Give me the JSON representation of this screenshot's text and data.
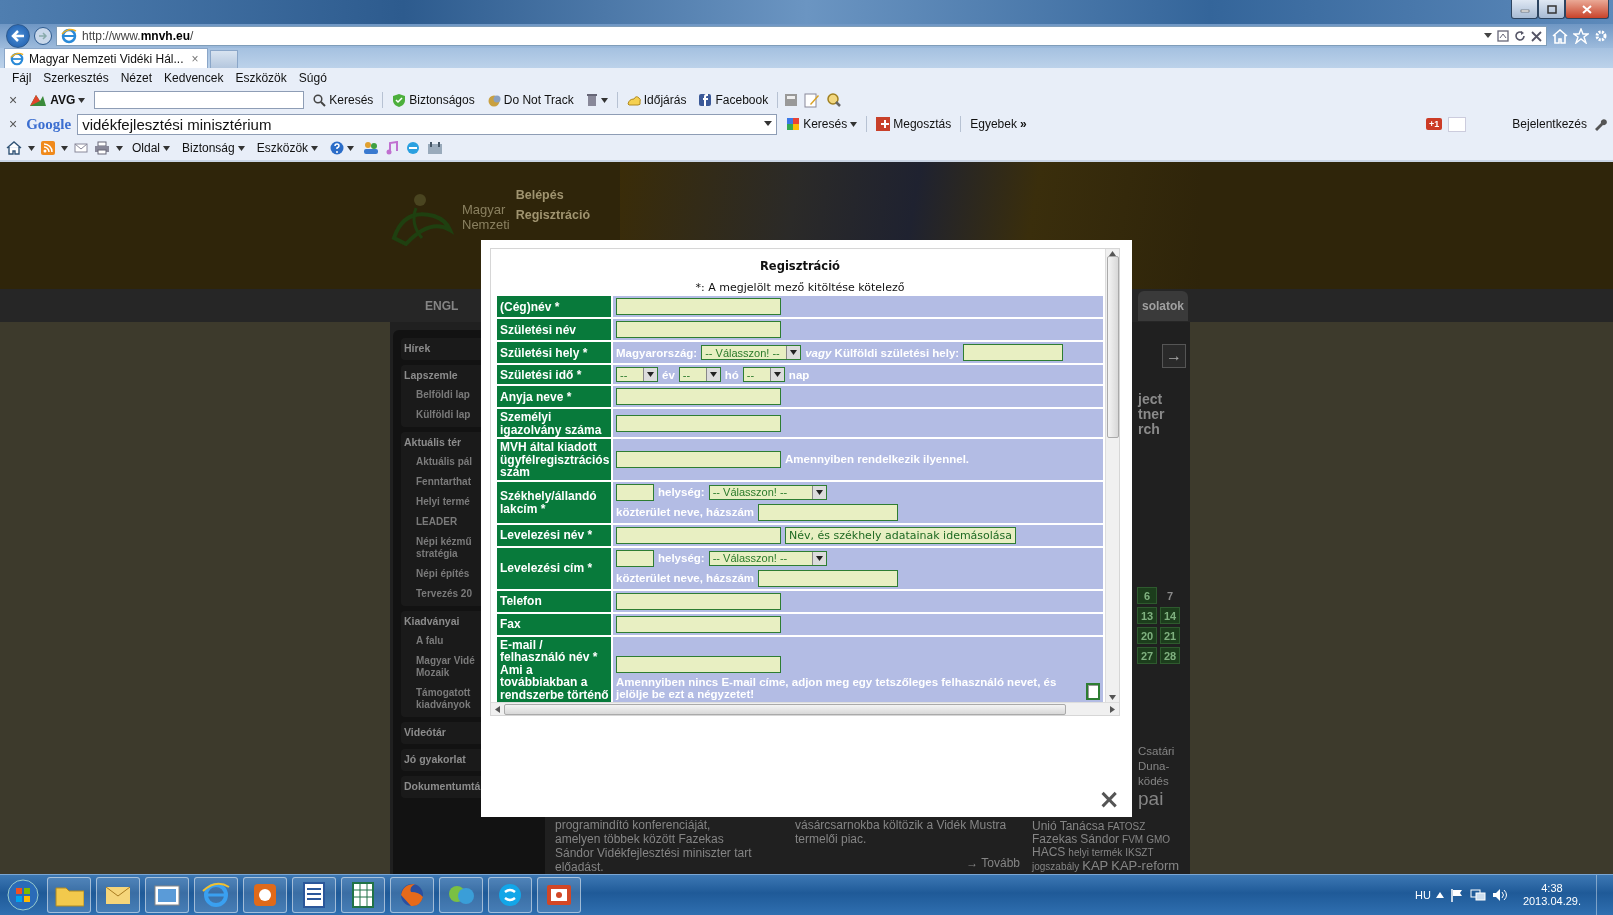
{
  "browser": {
    "address": "http://www.**mnvh.eu**/",
    "tab": {
      "title": "Magyar Nemzeti Vidéki Hál...",
      "close": "×"
    },
    "menu": [
      "Fájl",
      "Szerkesztés",
      "Nézet",
      "Kedvencek",
      "Eszközök",
      "Súgó"
    ],
    "avg_toolbar": {
      "close": "×",
      "brand": "AVG",
      "search_button": "Keresés",
      "items": [
        "Biztonságos",
        "Do Not Track",
        "Időjárás",
        "Facebook"
      ]
    },
    "google_toolbar": {
      "close": "×",
      "brand": "Google",
      "query": "vidékfejlesztési minisztérium",
      "search_button": "Keresés",
      "share": "Megosztás",
      "more": "Egyebek",
      "more_arrow": "»",
      "plus_one": "+1",
      "sign_in": "Bejelentkezés"
    },
    "command_bar": [
      "Oldal",
      "Biztonság",
      "Eszközök"
    ]
  },
  "page": {
    "logo_lines": [
      "Magyar",
      "Nemzeti"
    ],
    "header_links": [
      "Belépés",
      "Regisztráció"
    ],
    "nav": [
      "ENGL",
      "solatok"
    ],
    "sidebar": [
      {
        "label": "Hírek"
      },
      {
        "label": "Lapszemle",
        "children": [
          {
            "label": "Belföldi lap"
          },
          {
            "label": "Külföldi lap"
          }
        ]
      },
      {
        "label": "Aktuális tér",
        "children": [
          {
            "label": "Aktuális pál"
          },
          {
            "label": "Fenntarthat"
          },
          {
            "label": "Helyi termé"
          },
          {
            "label": "LEADER"
          },
          {
            "label": "Népi kézmű stratégia"
          },
          {
            "label": "Népi építés"
          },
          {
            "label": "Tervezés 20"
          }
        ]
      },
      {
        "label": "Kiadványai",
        "children": [
          {
            "label": "A falu"
          },
          {
            "label": "Magyar Vidé Mozaik"
          },
          {
            "label": "Támogatott kiadványok"
          }
        ]
      },
      {
        "label": "Videótár"
      },
      {
        "label": "Jó gyakorlat"
      },
      {
        "label": "Dokumentumtá"
      }
    ],
    "right_column": {
      "search_arrow": "→",
      "teaser": [
        "ject",
        "tner",
        "rch"
      ],
      "calendar": [
        {
          "day": "6",
          "highlighted": true
        },
        {
          "day": "7",
          "highlighted": false
        },
        {
          "day": "13",
          "highlighted": true
        },
        {
          "day": "14",
          "highlighted": true
        },
        {
          "day": "20",
          "highlighted": true
        },
        {
          "day": "21",
          "highlighted": true
        },
        {
          "day": "27",
          "highlighted": true
        },
        {
          "day": "28",
          "highlighted": true
        }
      ],
      "tag_fragments": [
        "Csatári",
        "Duna-",
        "ködés",
        "pai"
      ]
    },
    "news": [
      {
        "text": "programindító konferenciáját, amelyen többek között Fazekas Sándor Vidékfejlesztési miniszter tart előadást."
      },
      {
        "text": "vásárcsarnokba költözik a Vidék Mustra termelői piac.",
        "more": "→ Tovább"
      }
    ],
    "tag_cloud": [
      {
        "text": "Unió",
        "kind": "big"
      },
      {
        "text": "Tanácsa",
        "kind": "big"
      },
      {
        "text": "FATOSZ",
        "kind": "small"
      },
      {
        "text": "Fazekas",
        "kind": "big"
      },
      {
        "text": "Sándor",
        "kind": "big"
      },
      {
        "text": "FVM",
        "kind": "small"
      },
      {
        "text": "GMO",
        "kind": "small"
      },
      {
        "text": "HACS",
        "kind": "big"
      },
      {
        "text": "helyi termék",
        "kind": "small"
      },
      {
        "text": "IKSZT",
        "kind": "small"
      },
      {
        "text": "jogszabály",
        "kind": "small"
      },
      {
        "text": "KAP",
        "kind": "huge"
      },
      {
        "text": "KAP-reform",
        "kind": "huge"
      }
    ]
  },
  "modal": {
    "title": "Regisztráció",
    "note": "*: A megjelölt mező kitöltése kötelező",
    "close": "×",
    "rows": [
      {
        "label": "(Cég)név *",
        "kind": "text"
      },
      {
        "label": "Születési név",
        "kind": "text"
      },
      {
        "label": "Születési hely *",
        "kind": "birthplace",
        "prefix": "Magyarország:",
        "select": "-- Válasszon! --",
        "alternative": "*vagy* Külföldi születési hely:"
      },
      {
        "label": "Születési idő *",
        "kind": "date",
        "parts": [
          {
            "value": "--",
            "unit": "év"
          },
          {
            "value": "--",
            "unit": "hó"
          },
          {
            "value": "--",
            "unit": "nap"
          }
        ]
      },
      {
        "label": "Anyja neve *",
        "kind": "text"
      },
      {
        "label": "Személyi igazolvány száma",
        "kind": "text"
      },
      {
        "label": "MVH által kiadott ügyfélregisztrációs szám",
        "kind": "text_note",
        "note": "Amennyiben rendelkezik ilyennel."
      },
      {
        "label": "Székhely/állandó lakcím *",
        "kind": "address",
        "city_label": "helység:",
        "city_select": "-- Válasszon! --",
        "street_label": "közterület neve, házszám"
      },
      {
        "label": "Levelezési név *",
        "kind": "text_button",
        "button": "Név, és székhely adatainak idemásolása"
      },
      {
        "label": "Levelezési cím *",
        "kind": "address",
        "city_label": "helység:",
        "city_select": "-- Válasszon! --",
        "street_label": "közterület neve, házszám"
      },
      {
        "label": "Telefon",
        "kind": "text"
      },
      {
        "label": "Fax",
        "kind": "text"
      },
      {
        "label": "E-mail / felhasználó név * Ami a továbbiakban a rendszerbe történő",
        "kind": "email",
        "note": "Amennyiben nincs E-mail címe, adjon meg egy tetszőleges felhasználó nevet, és jelölje be ezt a négyzetet!",
        "checked": false
      }
    ]
  },
  "taskbar": {
    "language": "HU",
    "time": "4:38",
    "date": "2013.04.29."
  }
}
